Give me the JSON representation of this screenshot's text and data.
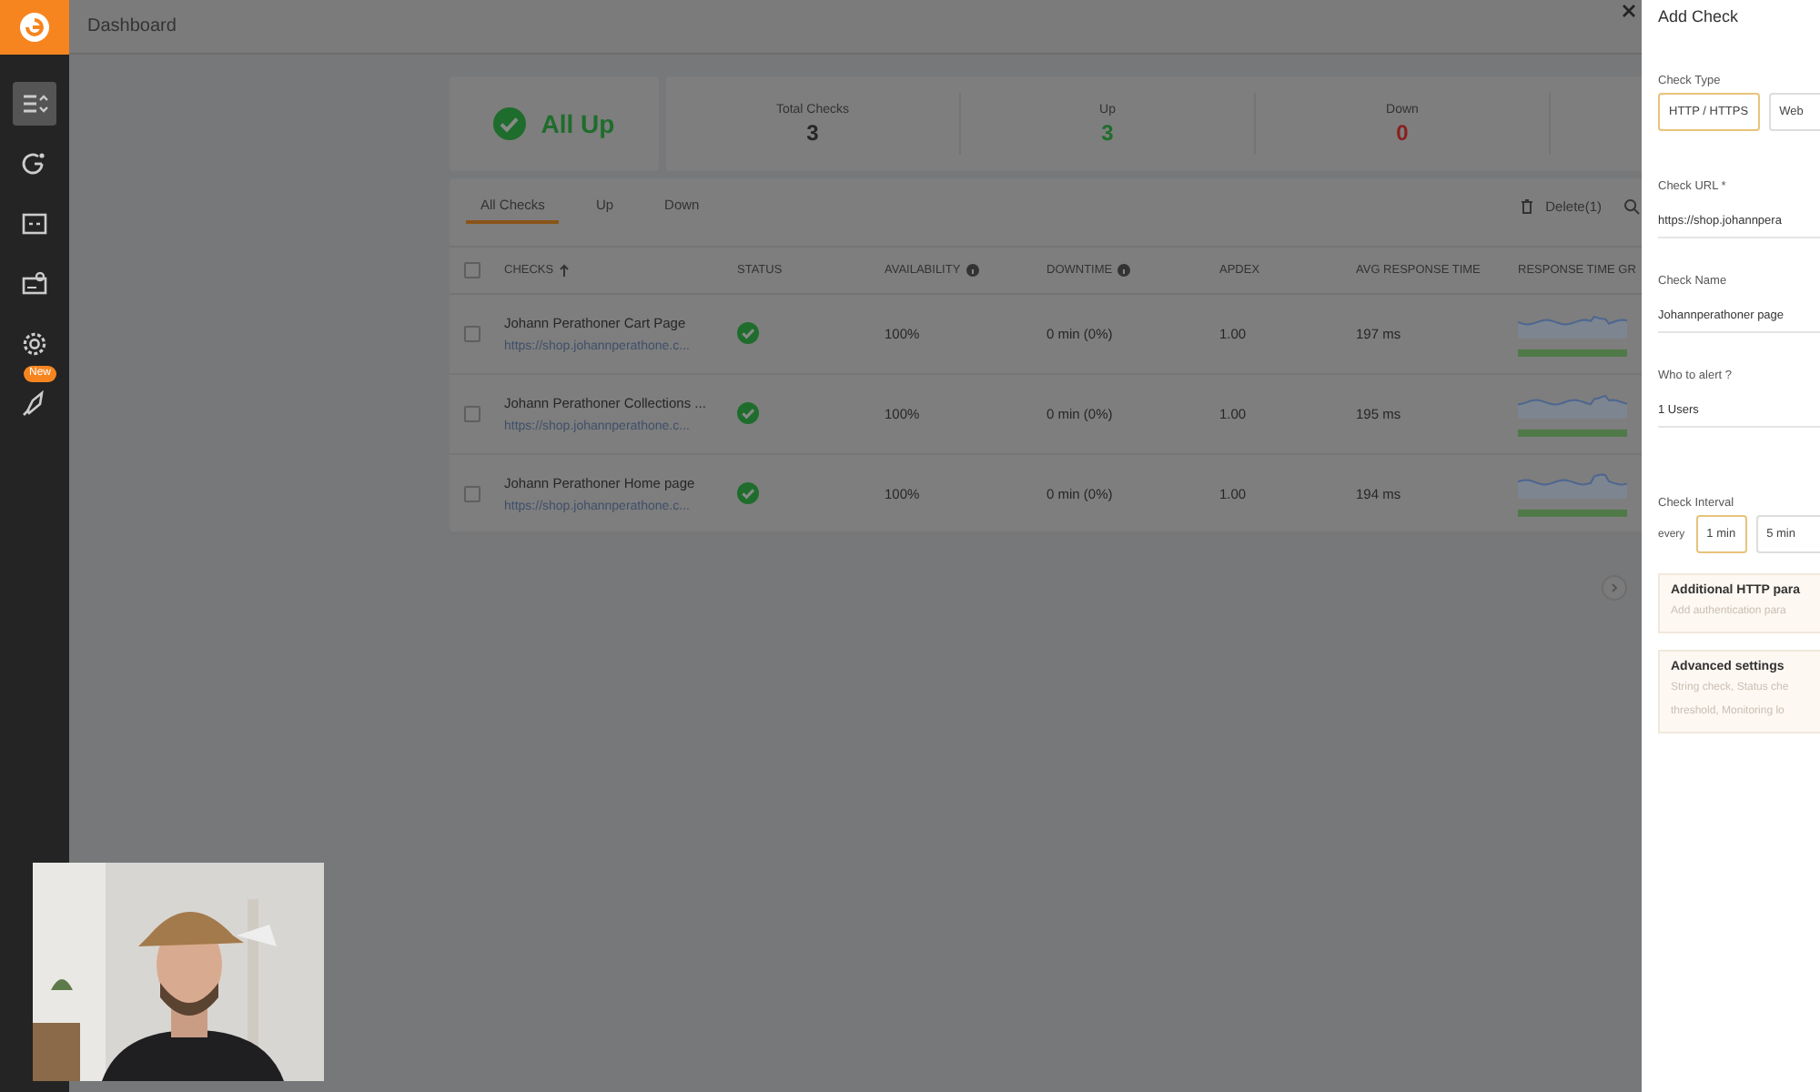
{
  "sidebar": {
    "nav": [
      {
        "selected": true
      },
      {
        "selected": false
      },
      {
        "selected": false
      },
      {
        "selected": false
      },
      {
        "selected": false
      },
      {
        "selected": false,
        "badge": "New"
      }
    ]
  },
  "header": {
    "title": "Dashboard"
  },
  "summary": {
    "status": "All Up",
    "stats": [
      {
        "kind": "total",
        "label": "Total Checks",
        "value": "3"
      },
      {
        "kind": "up",
        "label": "Up",
        "value": "3"
      },
      {
        "kind": "down",
        "label": "Down",
        "value": "0"
      }
    ]
  },
  "tabs": [
    {
      "label": "All Checks",
      "selected": true
    },
    {
      "label": "Up",
      "selected": false
    },
    {
      "label": "Down",
      "selected": false
    }
  ],
  "toolbar": {
    "delete": "Delete(1)"
  },
  "table": {
    "all_checked": false,
    "columns": [
      {
        "label": "CHECKS",
        "sorted": true,
        "info": false
      },
      {
        "label": "STATUS",
        "sorted": false,
        "info": false
      },
      {
        "label": "AVAILABILITY",
        "sorted": false,
        "info": true
      },
      {
        "label": "DOWNTIME",
        "sorted": false,
        "info": true
      },
      {
        "label": "APDEX",
        "sorted": false,
        "info": false
      },
      {
        "label": "AVG RESPONSE TIME",
        "sorted": false,
        "info": false
      },
      {
        "label": "RESPONSE TIME GR",
        "sorted": false,
        "info": false
      }
    ],
    "rows": [
      {
        "checked": false,
        "name": "Johann Perathoner Cart Page",
        "url": "https://shop.johannperathone.c...",
        "kind": "up",
        "availability": "100%",
        "downtime": "0 min (0%)",
        "apdex": "1.00",
        "avg_response": "197 ms"
      },
      {
        "checked": false,
        "name": "Johann Perathoner Collections ...",
        "url": "https://shop.johannperathone.c...",
        "kind": "up",
        "availability": "100%",
        "downtime": "0 min (0%)",
        "apdex": "1.00",
        "avg_response": "195 ms"
      },
      {
        "checked": false,
        "name": "Johann Perathoner Home page",
        "url": "https://shop.johannperathone.c...",
        "kind": "up",
        "availability": "100%",
        "downtime": "0 min (0%)",
        "apdex": "1.00",
        "avg_response": "194 ms"
      }
    ]
  },
  "panel": {
    "title": "Add Check",
    "check_type": {
      "label": "Check Type",
      "options": [
        {
          "label": "HTTP / HTTPS",
          "selected": true
        },
        {
          "label": "Web",
          "selected": false
        }
      ]
    },
    "fields": [
      {
        "label": "Check URL *",
        "value": "https://shop.johannpera"
      },
      {
        "label": "Check Name",
        "value": "Johannperathoner page"
      },
      {
        "label": "Who to alert ?",
        "value": "1 Users"
      }
    ],
    "interval": {
      "label": "Check Interval",
      "prefix": "every",
      "options": [
        {
          "label": "1 min",
          "selected": true
        },
        {
          "label": "5 min",
          "selected": false
        }
      ]
    },
    "sections": [
      {
        "title": "Additional HTTP para",
        "lines": [
          "Add authentication para"
        ]
      },
      {
        "title": "Advanced settings",
        "lines": [
          "String check, Status che",
          "threshold, Monitoring lo"
        ]
      }
    ]
  }
}
